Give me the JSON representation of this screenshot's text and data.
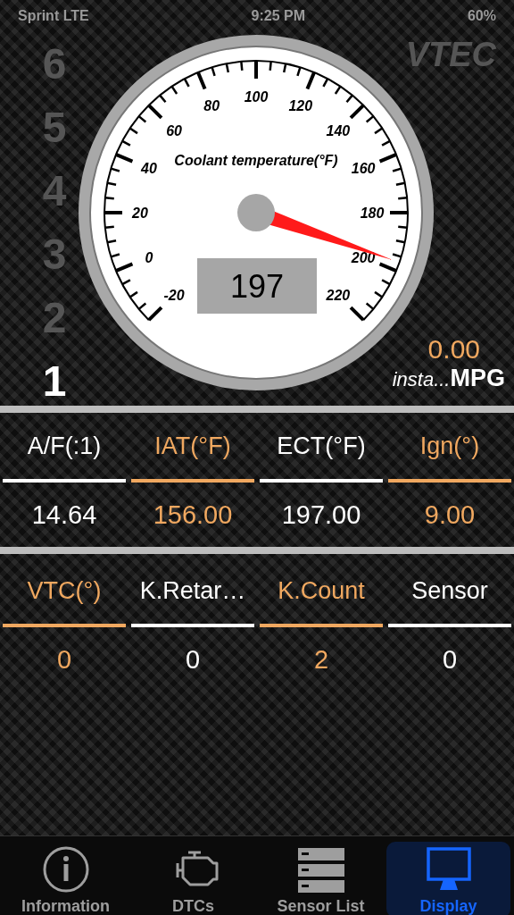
{
  "status_bar": {
    "carrier": "Sprint LTE",
    "time": "9:25 PM",
    "battery": "60%"
  },
  "gears": [
    {
      "label": "6",
      "selected": false
    },
    {
      "label": "5",
      "selected": false
    },
    {
      "label": "4",
      "selected": false
    },
    {
      "label": "3",
      "selected": false
    },
    {
      "label": "2",
      "selected": false
    },
    {
      "label": "1",
      "selected": true
    }
  ],
  "vtec": {
    "label": "VTEC",
    "on": false
  },
  "gauge": {
    "title": "Coolant temperature(°F)",
    "value": "197",
    "tick_labels": [
      "-20",
      "0",
      "20",
      "40",
      "60",
      "80",
      "100",
      "120",
      "140",
      "160",
      "180",
      "200",
      "220"
    ]
  },
  "mpg": {
    "value": "0.00",
    "label": "insta...",
    "unit": "MPG"
  },
  "sensor_rows": [
    [
      {
        "label": "A/F(:1)",
        "value": "14.64",
        "color": "#ffffff"
      },
      {
        "label": "IAT(°F)",
        "value": "156.00",
        "color": "#f0a860"
      },
      {
        "label": "ECT(°F)",
        "value": "197.00",
        "color": "#ffffff"
      },
      {
        "label": "Ign(°)",
        "value": "9.00",
        "color": "#f0a860"
      }
    ],
    [
      {
        "label": "VTC(°)",
        "value": "0",
        "color": "#f0a860"
      },
      {
        "label": "K.Retar…",
        "value": "0",
        "color": "#ffffff"
      },
      {
        "label": "K.Count",
        "value": "2",
        "color": "#f0a860"
      },
      {
        "label": "Sensor",
        "value": "0",
        "color": "#ffffff"
      }
    ]
  ],
  "tabs": [
    {
      "label": "Information",
      "selected": false
    },
    {
      "label": "DTCs",
      "selected": false
    },
    {
      "label": "Sensor List",
      "selected": false
    },
    {
      "label": "Display",
      "selected": true
    }
  ]
}
